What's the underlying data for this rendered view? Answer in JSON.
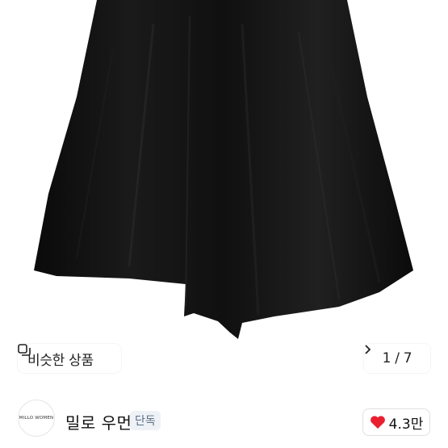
{
  "product_image": {
    "similar_label": "비슷한 상품",
    "similar_icon": "similar-items-icon",
    "page_counter": "1 / 7",
    "next_icon": "chevron-right-icon"
  },
  "seller": {
    "logo_text": "MILLO WOMEN",
    "name": "밀로 우먼",
    "badge": "단독",
    "likes": "4.3만",
    "heart_color": "#e8202f"
  }
}
